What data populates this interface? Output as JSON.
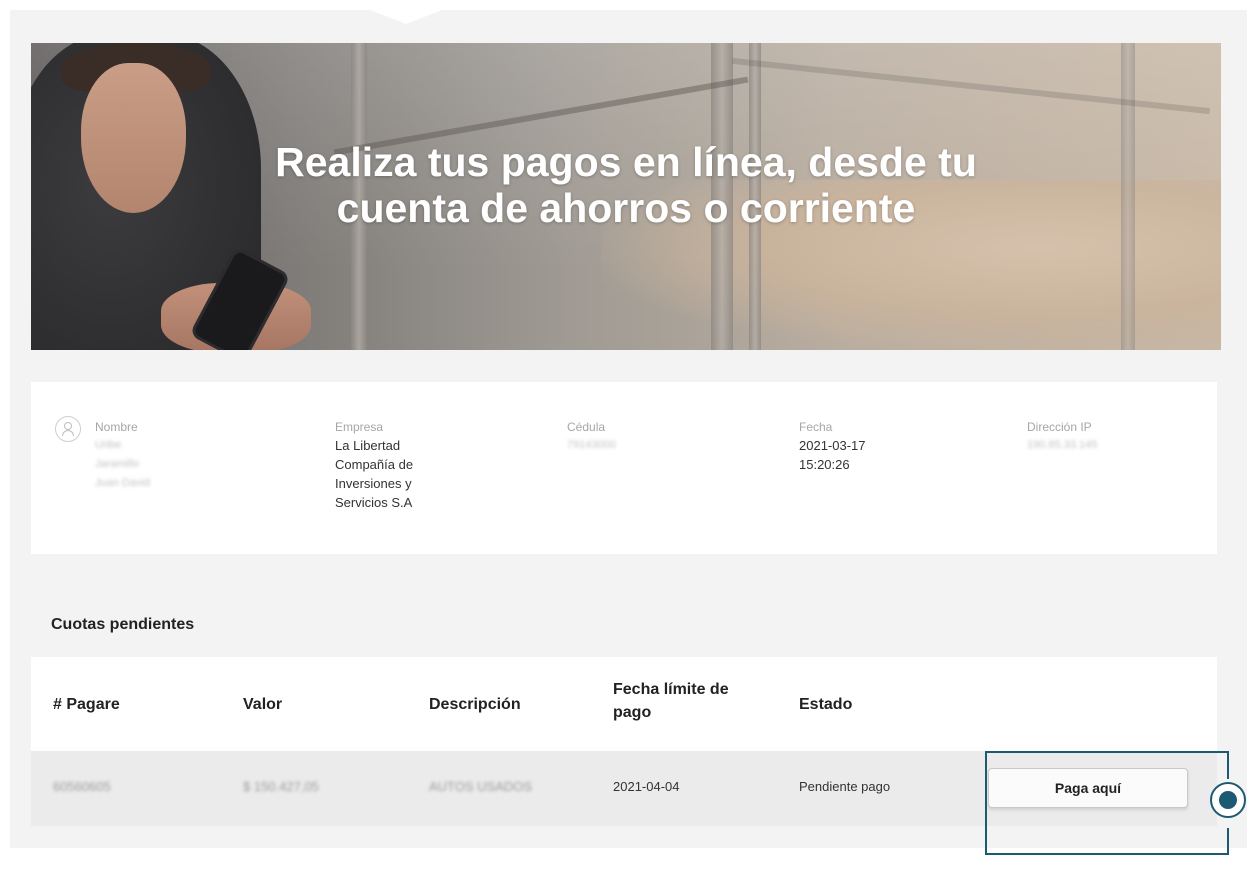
{
  "hero": {
    "title_line1": "Realiza tus pagos en línea, desde tu",
    "title_line2": "cuenta de ahorros o corriente"
  },
  "info": {
    "nombre": {
      "label": "Nombre",
      "lines": [
        "Uribe",
        "Jaramillo",
        "Juan David"
      ]
    },
    "empresa": {
      "label": "Empresa",
      "lines": [
        "La Libertad",
        "Compañía de",
        "Inversiones y",
        "Servicios S.A"
      ]
    },
    "cedula": {
      "label": "Cédula",
      "value": "79143000"
    },
    "fecha": {
      "label": "Fecha",
      "lines": [
        "2021-03-17",
        "15:20:26"
      ]
    },
    "ip": {
      "label": "Dirección IP",
      "value": "190.85.33.145"
    }
  },
  "section": {
    "title": "Cuotas pendientes"
  },
  "table": {
    "headers": {
      "pagare": "# Pagare",
      "valor": "Valor",
      "descripcion": "Descripción",
      "fecha_line1": "Fecha límite de",
      "fecha_line2": "pago",
      "estado": "Estado"
    },
    "rows": [
      {
        "pagare": "60560605",
        "valor": "$ 150.427,05",
        "descripcion": "AUTOS USADOS",
        "fecha": "2021-04-04",
        "estado": "Pendiente pago",
        "action": "Paga aquí"
      }
    ]
  },
  "colors": {
    "accent": "#1c5a72",
    "background": "#f3f3f3",
    "card": "#ffffff",
    "row": "#ebebeb"
  },
  "icons": {
    "user": "user-icon",
    "marker": "target-marker-icon"
  }
}
